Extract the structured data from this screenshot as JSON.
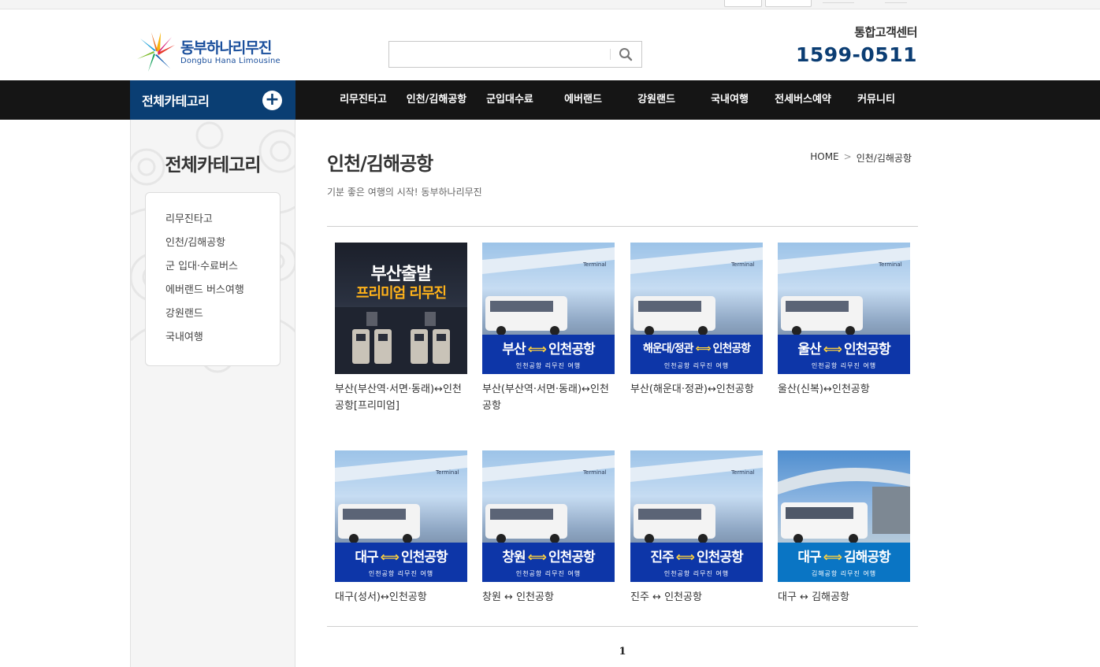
{
  "brand": {
    "name_ko": "동부하나리무진",
    "name_en": "Dongbu Hana Limousine"
  },
  "search": {
    "placeholder": ""
  },
  "customer_center": {
    "label": "통합고객센터",
    "phone": "1599-0511"
  },
  "gnb": {
    "all_category": "전체카테고리",
    "items": [
      "리무진타고",
      "인천/김해공항",
      "군입대수료",
      "에버랜드",
      "강원랜드",
      "국내여행",
      "전세버스예약",
      "커뮤니티"
    ]
  },
  "sidebar": {
    "title": "전체카테고리",
    "items": [
      "리무진타고",
      "인천/김해공항",
      "군 입대·수료버스",
      "에버랜드 버스여행",
      "강원랜드",
      "국내여행"
    ]
  },
  "page": {
    "title": "인천/김해공항",
    "subtitle": "기분 좋은 여행의 시작! 동부하나리무진",
    "breadcrumb": {
      "home": "HOME",
      "arrow": ">",
      "current": "인천/김해공항"
    }
  },
  "products": [
    {
      "title": "부산(부산역·서면·동래)↔인천공항[프리미엄]",
      "thumb_line1": "부산출발",
      "thumb_line2": "프리미엄 리무진"
    },
    {
      "title": "부산(부산역·서면·동래)↔인천공항",
      "from": "부산",
      "to": "인천공항",
      "small": "인천공항 리무진 여행"
    },
    {
      "title": "부산(해운대·정관)↔인천공항",
      "from": "해운대/정관",
      "to": "인천공항",
      "small": "인천공항 리무진 여행"
    },
    {
      "title": "울산(신복)↔인천공항",
      "from": "울산",
      "to": "인천공항",
      "small": "인천공항 리무진 여행"
    },
    {
      "title": "대구(성서)↔인천공항",
      "from": "대구",
      "to": "인천공항",
      "small": "인천공항 리무진 여행"
    },
    {
      "title": "창원 ↔ 인천공항",
      "from": "창원",
      "to": "인천공항",
      "small": "인천공항 리무진 여행"
    },
    {
      "title": "진주 ↔ 인천공항",
      "from": "진주",
      "to": "인천공항",
      "small": "인천공항 리무진 여행"
    },
    {
      "title": "대구 ↔ 김해공항",
      "from": "대구",
      "to": "김해공항",
      "small": "김해공항 리무진 여행"
    }
  ],
  "pagination": {
    "current": "1"
  },
  "colors": {
    "navy": "#0a3e73",
    "gnb_bg": "#151515",
    "banner_blue": "#0d36a8",
    "arrow_yellow": "#ffd23f"
  }
}
